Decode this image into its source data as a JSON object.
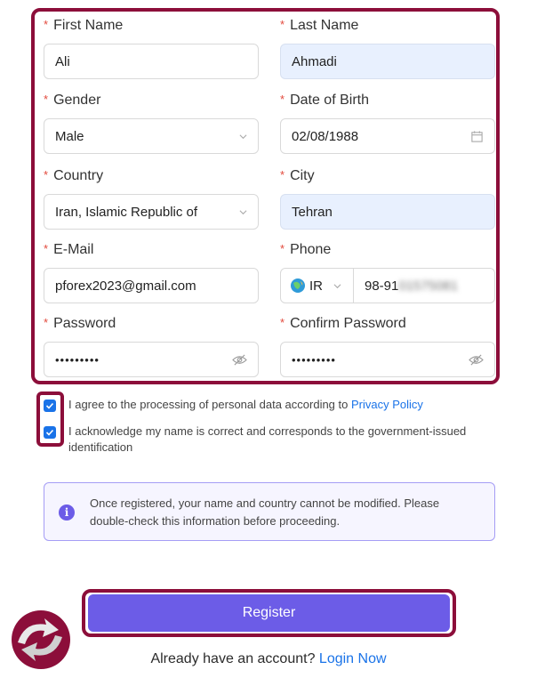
{
  "form": {
    "first_name": {
      "label": "First Name",
      "value": "Ali"
    },
    "last_name": {
      "label": "Last Name",
      "value": "Ahmadi"
    },
    "gender": {
      "label": "Gender",
      "value": "Male"
    },
    "dob": {
      "label": "Date of Birth",
      "value": "02/08/1988"
    },
    "country": {
      "label": "Country",
      "value": "Iran, Islamic Republic of"
    },
    "city": {
      "label": "City",
      "value": "Tehran"
    },
    "email": {
      "label": "E-Mail",
      "value": "pforex2023@gmail.com"
    },
    "phone": {
      "label": "Phone",
      "country_code": "IR",
      "value_prefix": "98-91",
      "value_hidden": "01575081"
    },
    "password": {
      "label": "Password",
      "value": "•••••••••"
    },
    "confirm_password": {
      "label": "Confirm Password",
      "value": "•••••••••"
    },
    "required_marker": "*"
  },
  "agreements": {
    "privacy_text": "I agree to the processing of personal data according to ",
    "privacy_link": "Privacy Policy",
    "privacy_checked": true,
    "name_text": "I acknowledge my name is correct and corresponds to the government-issued identification",
    "name_checked": true
  },
  "notice": {
    "icon": "info-icon",
    "text": "Once registered, your name and country cannot be modified. Please double-check this information before proceeding."
  },
  "register_label": "Register",
  "footer": {
    "text": "Already have an account?",
    "link": "Login Now"
  },
  "colors": {
    "accent": "#6c5ce7",
    "highlight_frame": "#8c0e3a",
    "link": "#1a73e8",
    "required": "#e2493c",
    "autofill_bg": "#e8f0fe"
  }
}
